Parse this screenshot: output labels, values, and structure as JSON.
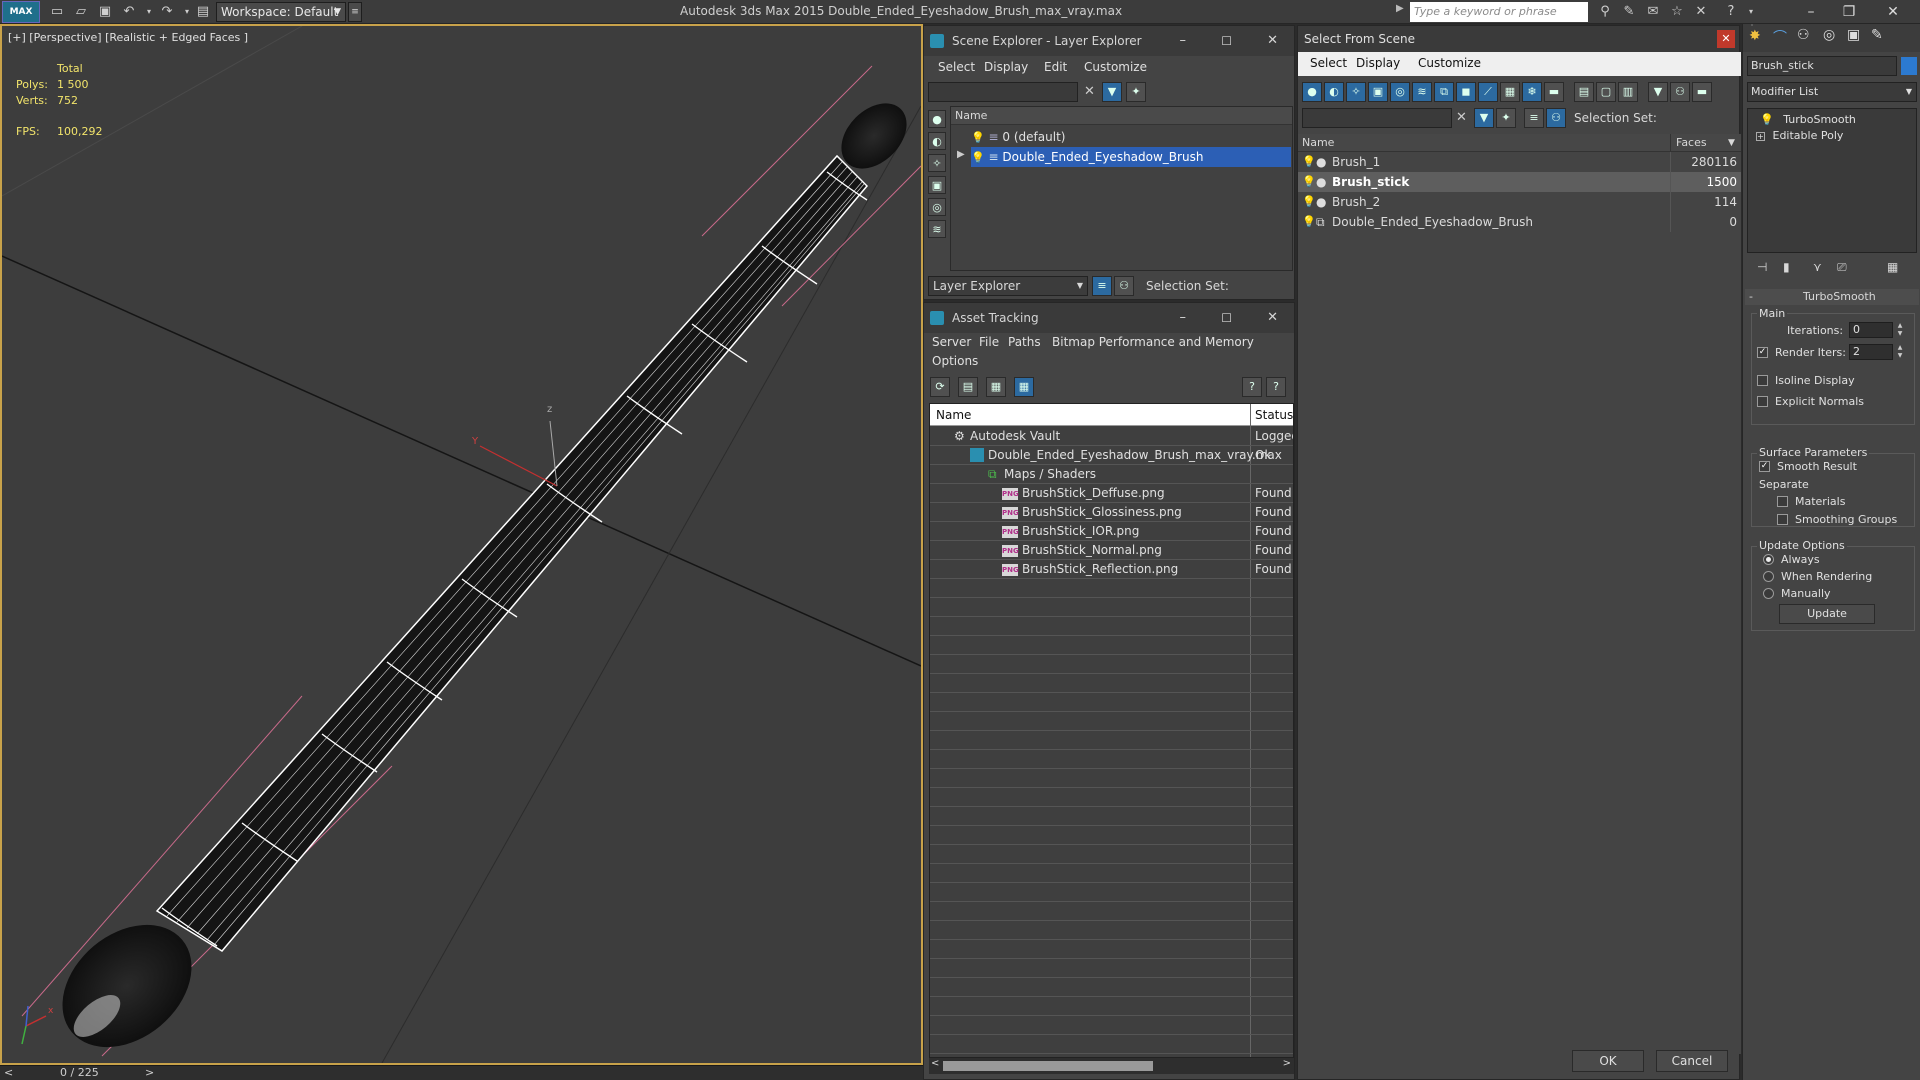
{
  "titlebar": {
    "logo": "MAX",
    "workspace": "Workspace: Default",
    "app_title": "Autodesk 3ds Max  2015    Double_Ended_Eyeshadow_Brush_max_vray.max",
    "search_placeholder": "Type a keyword or phrase"
  },
  "viewport": {
    "label": "[+] [Perspective] [Realistic + Edged Faces ]",
    "stats": {
      "total_label": "Total",
      "polys_label": "Polys:",
      "polys_value": "1 500",
      "verts_label": "Verts:",
      "verts_value": "752",
      "fps_label": "FPS:",
      "fps_value": "100,292"
    },
    "gizmo": {
      "x": "x",
      "y": "Y",
      "z": "z"
    },
    "timeline": "0 / 225"
  },
  "scene_explorer": {
    "title": "Scene Explorer - Layer Explorer",
    "menu": [
      "Select",
      "Display",
      "Edit",
      "Customize"
    ],
    "column_name": "Name",
    "rows": [
      "0 (default)",
      "Double_Ended_Eyeshadow_Brush"
    ],
    "footer_dropdown": "Layer Explorer",
    "selection_set_label": "Selection Set:"
  },
  "asset_tracking": {
    "title": "Asset Tracking",
    "menu": [
      "Server",
      "File",
      "Paths",
      "Bitmap Performance and Memory",
      "Options"
    ],
    "columns": [
      "Name",
      "Status"
    ],
    "rows": [
      {
        "name": "Autodesk Vault",
        "status": "Logged"
      },
      {
        "name": "Double_Ended_Eyeshadow_Brush_max_vray.max",
        "status": "Ok"
      },
      {
        "name": "Maps / Shaders",
        "status": ""
      },
      {
        "name": "BrushStick_Deffuse.png",
        "status": "Found"
      },
      {
        "name": "BrushStick_Glossiness.png",
        "status": "Found"
      },
      {
        "name": "BrushStick_IOR.png",
        "status": "Found"
      },
      {
        "name": "BrushStick_Normal.png",
        "status": "Found"
      },
      {
        "name": "BrushStick_Reflection.png",
        "status": "Found"
      }
    ]
  },
  "select_from_scene": {
    "title": "Select From Scene",
    "menu": [
      "Select",
      "Display",
      "Customize"
    ],
    "selection_set_label": "Selection Set:",
    "columns": [
      "Name",
      "Faces"
    ],
    "rows": [
      {
        "name": "Brush_1",
        "faces": "280116"
      },
      {
        "name": "Brush_stick",
        "faces": "1500"
      },
      {
        "name": "Brush_2",
        "faces": "114"
      },
      {
        "name": "Double_Ended_Eyeshadow_Brush",
        "faces": "0"
      }
    ],
    "ok_label": "OK",
    "cancel_label": "Cancel"
  },
  "command_panel": {
    "object_name": "Brush_stick",
    "modifier_list": "Modifier List",
    "stack": [
      "TurboSmooth",
      "Editable Poly"
    ],
    "rollout_title": "TurboSmooth",
    "main_label": "Main",
    "iterations_label": "Iterations:",
    "iterations_value": "0",
    "render_iters_label": "Render Iters:",
    "render_iters_value": "2",
    "isoline_label": "Isoline Display",
    "explicit_normals_label": "Explicit Normals",
    "surface_label": "Surface Parameters",
    "smooth_result_label": "Smooth Result",
    "separate_label": "Separate",
    "materials_label": "Materials",
    "smoothing_groups_label": "Smoothing Groups",
    "update_options_label": "Update Options",
    "always_label": "Always",
    "when_rendering_label": "When Rendering",
    "manually_label": "Manually",
    "update_button": "Update"
  }
}
